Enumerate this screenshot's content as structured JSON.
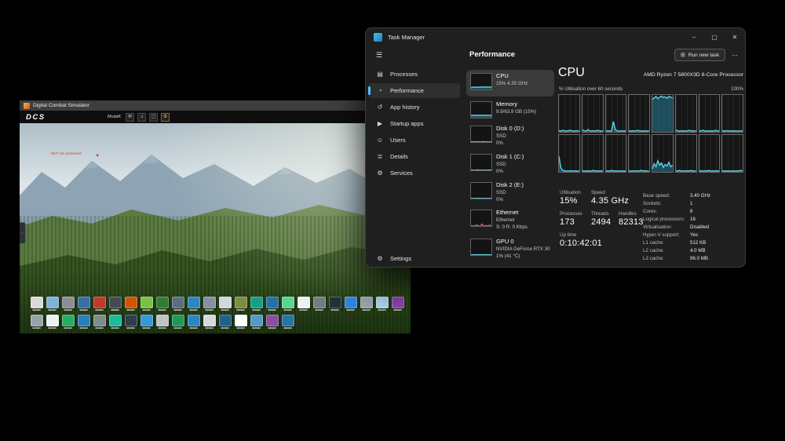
{
  "dcs": {
    "window_title": "Digital Combat Simulator",
    "logo": "DCS",
    "user": "MulatK",
    "menu_icons": [
      {
        "name": "mail-icon",
        "glyph": "✉"
      },
      {
        "name": "audio-icon",
        "glyph": "♫"
      },
      {
        "name": "display-icon",
        "glyph": "▢"
      },
      {
        "name": "settings-icon",
        "glyph": "⚙"
      }
    ],
    "warning": "NET not connected",
    "side_tab_glyph": "›",
    "dock_row1_colors": [
      "#d9d9d9",
      "#7fb2d9",
      "#8a8f94",
      "#3a6ea5",
      "#c0392b",
      "#444a50",
      "#d35400",
      "#7ac143",
      "#2e7d32",
      "#5d6d7e",
      "#2e86c1",
      "#85929e",
      "#cfd8dc",
      "#7d8c3f",
      "#16a085",
      "#2471a3",
      "#58d68d",
      "#ecf0f1",
      "#717d7e",
      "#22303a",
      "#2e86de",
      "#9aa5ab",
      "#aed6f1",
      "#8e44ad"
    ],
    "dock_row2_colors": [
      "#95a5a6",
      "#ecf0f1",
      "#27ae60",
      "#2980b9",
      "#7f8c8d",
      "#1abc9c",
      "#2c3e50",
      "#3498db",
      "#bdc3c7",
      "#229954",
      "#2e86c1",
      "#d5dbdb",
      "#21618c",
      "#fdfefe",
      "#5499c7",
      "#884ea0",
      "#2874a6"
    ]
  },
  "task_manager": {
    "title": "Task Manager",
    "window_controls": {
      "minimize": "–",
      "maximize": "▢",
      "close": "✕"
    },
    "hamburger": "☰",
    "page_title": "Performance",
    "run_new_task": {
      "icon": "⊞",
      "label": "Run new task"
    },
    "more": "⋯",
    "sidebar": {
      "items": [
        {
          "label": "Processes",
          "icon": "▤"
        },
        {
          "label": "Performance",
          "icon": "◔"
        },
        {
          "label": "App history",
          "icon": "↺"
        },
        {
          "label": "Startup apps",
          "icon": "▶"
        },
        {
          "label": "Users",
          "icon": "☺"
        },
        {
          "label": "Details",
          "icon": "≣"
        },
        {
          "label": "Services",
          "icon": "⚙"
        }
      ],
      "settings": {
        "label": "Settings",
        "icon": "⚙"
      }
    },
    "perf_cards": [
      {
        "name": "CPU",
        "line2": "15% 4.35 GHz"
      },
      {
        "name": "Memory",
        "line2": "9.9/63.9 GB (15%)"
      },
      {
        "name": "Disk 0 (D:)",
        "line2": "SSD",
        "line3": "0%"
      },
      {
        "name": "Disk 1 (C:)",
        "line2": "SSD",
        "line3": "0%"
      },
      {
        "name": "Disk 2 (E:)",
        "line2": "SSD",
        "line3": "0%"
      },
      {
        "name": "Ethernet",
        "line2": "Ethernet",
        "line3": "S: 0 R: 0 Kbps"
      },
      {
        "name": "GPU 0",
        "line2": "NVIDIA GeForce RTX 30",
        "line3": "1% (41 °C)"
      }
    ],
    "cpu_panel": {
      "title": "CPU",
      "subtitle": "AMD Ryzen 7 5800X3D 8-Core Processor",
      "graph_caption": "% Utilisation over 60 seconds",
      "graph_max": "100%",
      "stats": {
        "utilisation": {
          "label": "Utilisation",
          "value": "15%"
        },
        "speed": {
          "label": "Speed",
          "value": "4.35 GHz"
        },
        "processes": {
          "label": "Processes",
          "value": "173"
        },
        "threads": {
          "label": "Threads",
          "value": "2494"
        },
        "handles": {
          "label": "Handles",
          "value": "82313"
        },
        "uptime": {
          "label": "Up time",
          "value": "0:10:42:01"
        }
      },
      "details": [
        {
          "label": "Base speed:",
          "value": "3.40 GHz"
        },
        {
          "label": "Sockets:",
          "value": "1"
        },
        {
          "label": "Cores:",
          "value": "8"
        },
        {
          "label": "Logical processors:",
          "value": "16"
        },
        {
          "label": "Virtualisation:",
          "value": "Disabled"
        },
        {
          "label": "Hyper-V support:",
          "value": "Yes"
        },
        {
          "label": "L1 cache:",
          "value": "512 KB"
        },
        {
          "label": "L2 cache:",
          "value": "4.0 MB"
        },
        {
          "label": "L3 cache:",
          "value": "96.0 MB"
        }
      ]
    }
  },
  "colors": {
    "accent": "#4cc2ff",
    "graph_stroke": "#5fc9da",
    "graph_fill": "rgba(33,95,112,0.78)",
    "net_stroke": "#c0564c",
    "net_fill": "rgba(146,62,52,0.45)"
  },
  "chart_data": {
    "type": "line",
    "title": "% Utilisation over 60 seconds",
    "ylabel": "% utilisation",
    "ylim": [
      0,
      100
    ],
    "x_window_seconds": 60,
    "cores": [
      [
        3,
        2,
        4,
        3,
        2,
        3,
        4,
        3,
        2,
        3,
        3,
        2
      ],
      [
        5,
        3,
        2,
        6,
        3,
        2,
        3,
        2,
        4,
        3,
        2,
        3
      ],
      [
        2,
        3,
        2,
        3,
        28,
        6,
        3,
        2,
        3,
        2,
        3,
        2
      ],
      [
        3,
        2,
        3,
        2,
        3,
        4,
        2,
        3,
        2,
        3,
        2,
        3
      ],
      [
        88,
        92,
        96,
        90,
        94,
        97,
        93,
        95,
        91,
        96,
        94,
        92
      ],
      [
        4,
        3,
        2,
        3,
        2,
        3,
        2,
        4,
        3,
        2,
        3,
        2
      ],
      [
        2,
        3,
        4,
        2,
        3,
        2,
        3,
        2,
        3,
        4,
        2,
        3
      ],
      [
        3,
        2,
        3,
        3,
        2,
        3,
        2,
        3,
        2,
        2,
        3,
        2
      ],
      [
        42,
        12,
        4,
        3,
        2,
        3,
        2,
        3,
        2,
        3,
        2,
        3
      ],
      [
        3,
        2,
        3,
        2,
        3,
        2,
        4,
        2,
        3,
        2,
        3,
        2
      ],
      [
        2,
        3,
        2,
        4,
        2,
        3,
        2,
        3,
        2,
        3,
        2,
        3
      ],
      [
        3,
        2,
        3,
        2,
        3,
        2,
        3,
        4,
        2,
        3,
        2,
        2
      ],
      [
        8,
        22,
        14,
        30,
        18,
        24,
        12,
        20,
        16,
        26,
        14,
        18
      ],
      [
        3,
        2,
        4,
        2,
        3,
        2,
        3,
        2,
        4,
        2,
        3,
        2
      ],
      [
        2,
        3,
        2,
        3,
        2,
        4,
        2,
        3,
        2,
        3,
        2,
        3
      ],
      [
        3,
        2,
        3,
        2,
        3,
        2,
        3,
        2,
        3,
        2,
        4,
        2
      ]
    ],
    "thumbs": {
      "cpu": [
        12,
        15,
        13,
        16,
        14,
        15,
        17,
        14,
        15,
        16,
        15,
        15
      ],
      "memory": [
        15,
        15,
        16,
        15,
        15,
        15,
        16,
        15,
        15,
        15,
        15,
        15
      ],
      "disk0": [
        1,
        0,
        2,
        0,
        1,
        0,
        1,
        2,
        0,
        1,
        0,
        1
      ],
      "disk1": [
        0,
        1,
        0,
        1,
        2,
        0,
        1,
        0,
        1,
        0,
        2,
        0
      ],
      "disk2": [
        1,
        0,
        1,
        0,
        1,
        1,
        0,
        1,
        0,
        1,
        0,
        1
      ],
      "ethernet": [
        0,
        2,
        0,
        8,
        0,
        1,
        12,
        0,
        3,
        0,
        6,
        0
      ],
      "gpu": [
        1,
        1,
        2,
        1,
        1,
        2,
        1,
        1,
        1,
        2,
        1,
        1
      ]
    }
  }
}
